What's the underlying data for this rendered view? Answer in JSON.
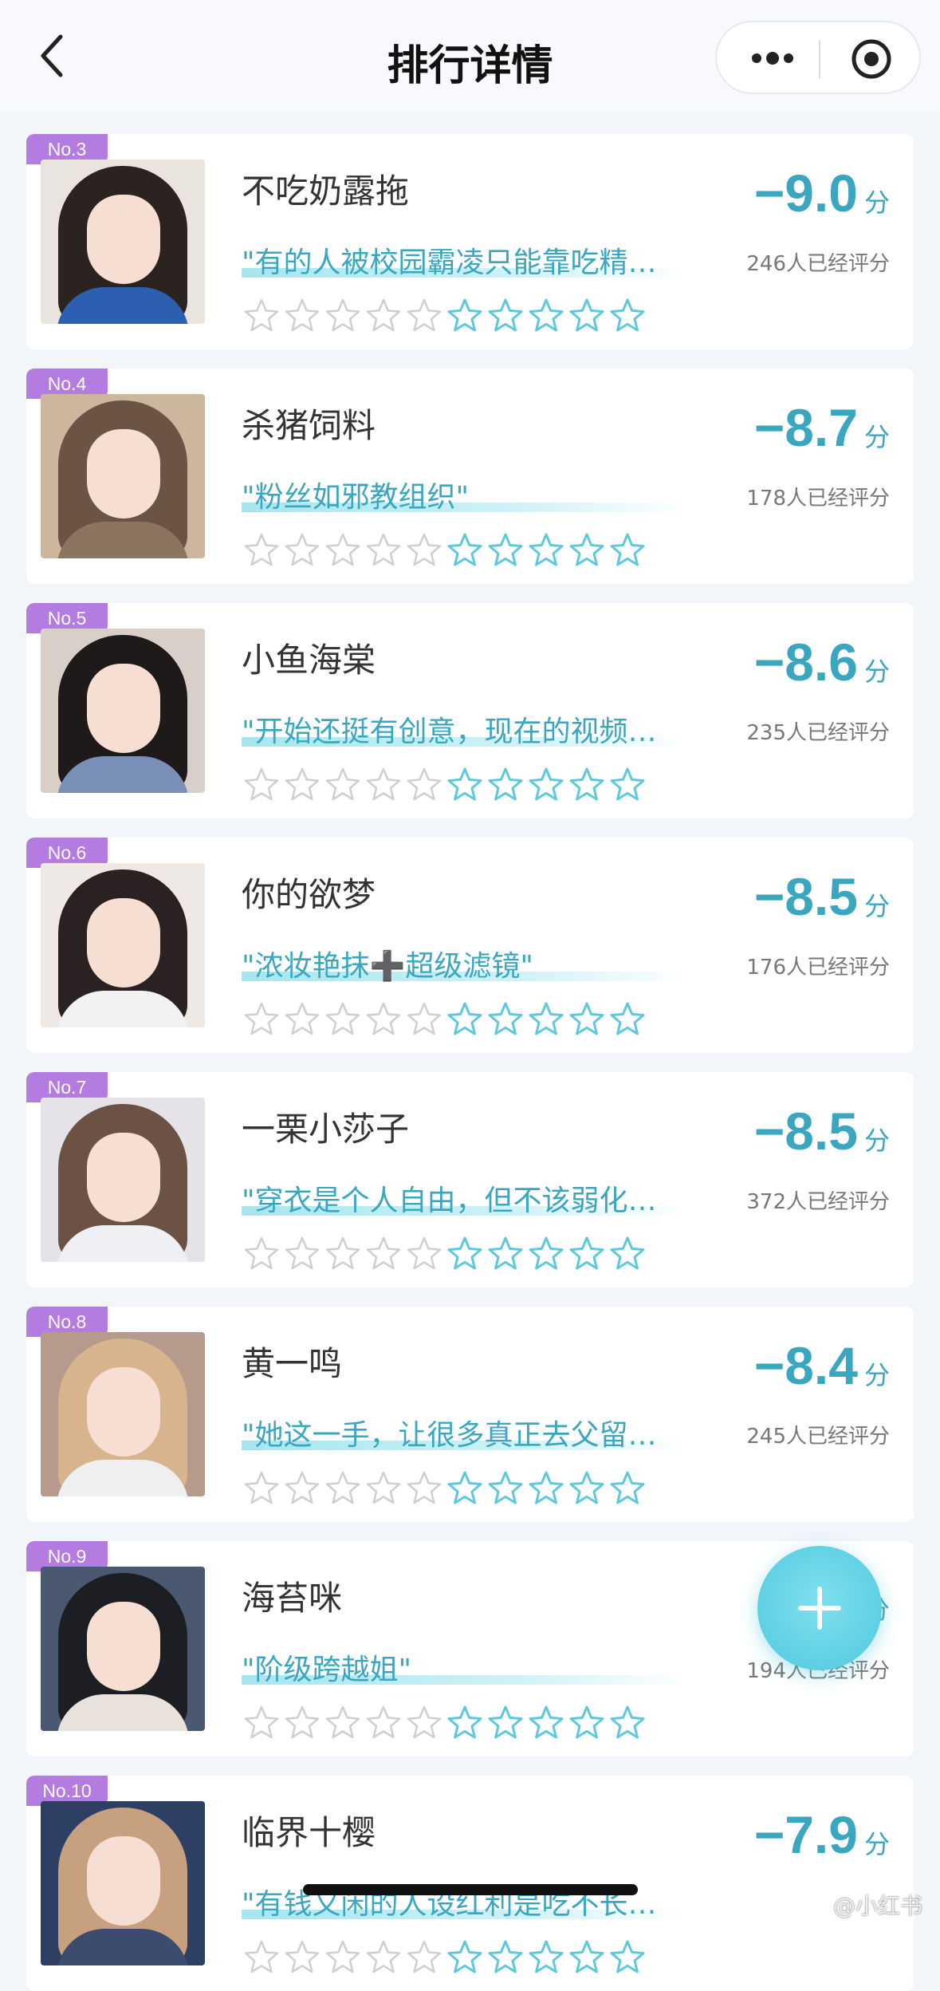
{
  "header": {
    "title": "排行详情",
    "back_icon": "chevron-left-icon",
    "more_icon": "more-dots-icon",
    "close_icon": "target-circle-icon"
  },
  "colors": {
    "accent": "#3aa6bf",
    "badge": "#b47be0",
    "fab": "#5ed0e3"
  },
  "items": [
    {
      "rank": "No.3",
      "name": "不吃奶露拖",
      "quote": "\"有的人被校园霸凌只能靠吃精…",
      "score": "−9.0",
      "unit": "分",
      "raters": "246人已经评分"
    },
    {
      "rank": "No.4",
      "name": "杀猪饲料",
      "quote": "\"粉丝如邪教组织\"",
      "score": "−8.7",
      "unit": "分",
      "raters": "178人已经评分"
    },
    {
      "rank": "No.5",
      "name": "小鱼海棠",
      "quote": "\"开始还挺有创意，现在的视频…",
      "score": "−8.6",
      "unit": "分",
      "raters": "235人已经评分"
    },
    {
      "rank": "No.6",
      "name": "你的欲梦",
      "quote": "\"浓妆艳抹➕超级滤镜\"",
      "score": "−8.5",
      "unit": "分",
      "raters": "176人已经评分"
    },
    {
      "rank": "No.7",
      "name": "一栗小莎子",
      "quote": "\"穿衣是个人自由，但不该弱化…",
      "score": "−8.5",
      "unit": "分",
      "raters": "372人已经评分"
    },
    {
      "rank": "No.8",
      "name": "黄一鸣",
      "quote": "\"她这一手，让很多真正去父留…",
      "score": "−8.4",
      "unit": "分",
      "raters": "245人已经评分"
    },
    {
      "rank": "No.9",
      "name": "海苔咪",
      "quote": "\"阶级跨越姐\"",
      "score": "",
      "unit": "分",
      "raters": "194人已经评分"
    },
    {
      "rank": "No.10",
      "name": "临界十樱",
      "quote": "\"有钱又闲的人设红利是吃不长…",
      "score": "−7.9",
      "unit": "分",
      "raters": ""
    }
  ],
  "stars": {
    "empty_gray": 5,
    "empty_blue": 5
  },
  "fab_icon": "plus-icon",
  "watermark": "@小红书"
}
